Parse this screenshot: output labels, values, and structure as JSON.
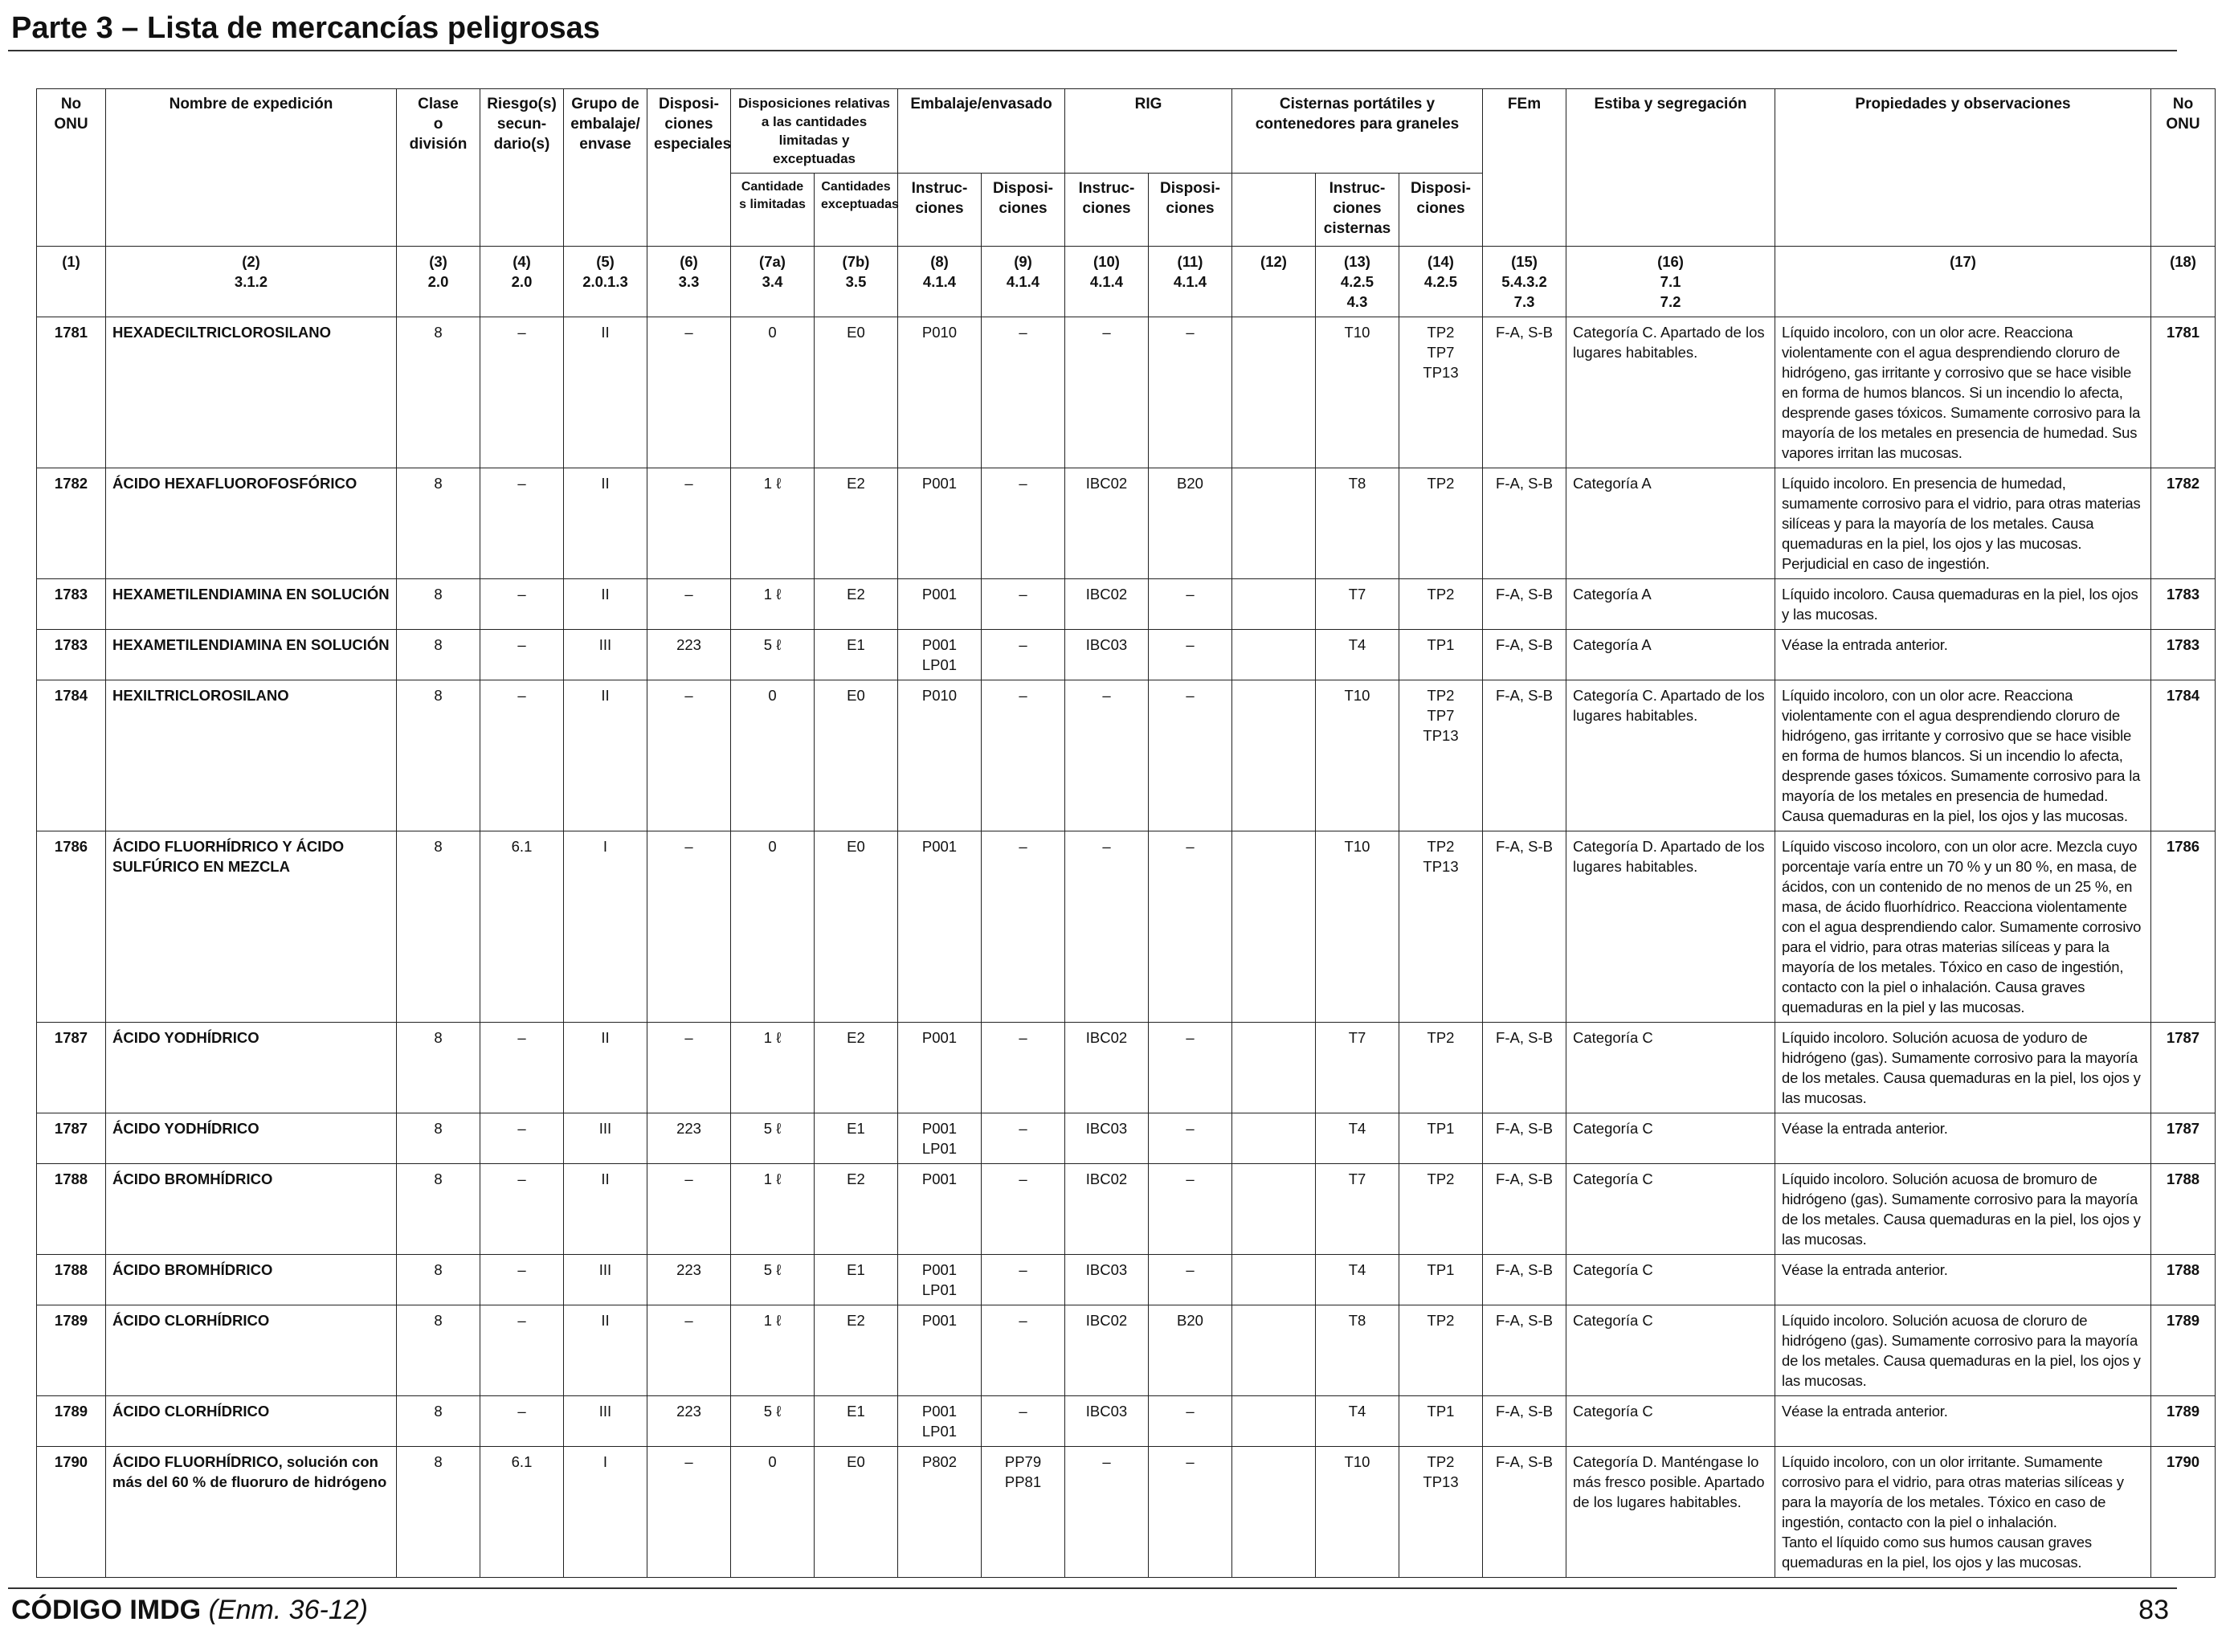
{
  "page": {
    "title": "Parte 3 – Lista de mercancías peligrosas",
    "footer_code": "CÓDIGO IMDG",
    "footer_amendment": "(Enm. 36-12)",
    "page_number": "83"
  },
  "table": {
    "headers": {
      "no_onu": "No\nONU",
      "nombre": "Nombre de expedición",
      "clase": "Clase\no\ndivisión",
      "riesgo": "Riesgo(s)\nsecun-\ndario(s)",
      "grupo": "Grupo de\nembalaje/\nenvase",
      "disposiciones": "Disposi-\nciones\nespeciales",
      "cantidades_group": "Disposiciones relativas\na las cantidades\nlimitadas y exceptuadas",
      "cantidad_limitada": "Cantidade\ns limitadas",
      "cantidad_exceptuada": "Cantidades\nexceptuadas",
      "embalaje_group": "Embalaje/envasado",
      "emb_instr": "Instruc-\nciones",
      "emb_disp": "Disposi-\nciones",
      "rig_group": "RIG",
      "rig_instr": "Instruc-\nciones",
      "rig_disp": "Disposi-\nciones",
      "cisternas_group": "Cisternas portátiles y\ncontenedores para graneles",
      "cist_instr": "Instruc-\nciones\ncisternas",
      "cist_disp": "Disposi-\nciones",
      "fem": "FEm",
      "estiba": "Estiba y segregación",
      "propiedades": "Propiedades y observaciones",
      "no_onu_right": "No\nONU"
    },
    "column_numbers": [
      "(1)",
      "(2)\n3.1.2",
      "(3)\n2.0",
      "(4)\n2.0",
      "(5)\n2.0.1.3",
      "(6)\n3.3",
      "(7a)\n3.4",
      "(7b)\n3.5",
      "(8)\n4.1.4",
      "(9)\n4.1.4",
      "(10)\n4.1.4",
      "(11)\n4.1.4",
      "(12)",
      "(13)\n4.2.5\n4.3",
      "(14)\n4.2.5",
      "(15)\n5.4.3.2\n7.3",
      "(16)\n7.1\n7.2",
      "(17)",
      "(18)"
    ],
    "rows": [
      {
        "c": [
          "1781",
          "HEXADECILTRICLOROSILANO",
          "8",
          "–",
          "II",
          "–",
          "0",
          "E0",
          "P010",
          "–",
          "–",
          "–",
          "",
          "T10",
          "TP2\nTP7\nTP13",
          "F-A, S-B",
          "Categoría C. Apartado de los lugares habitables.",
          "Líquido incoloro, con un olor acre. Reacciona violentamente con el agua desprendiendo cloruro de hidrógeno, gas irritante y corrosivo que se hace visible en forma de humos blancos. Si un incendio lo afecta, desprende gases tóxicos. Sumamente corrosivo para la mayoría de los metales en presencia de humedad. Sus vapores irritan las mucosas.",
          "1781"
        ]
      },
      {
        "c": [
          "1782",
          "ÁCIDO HEXAFLUOROFOSFÓRICO",
          "8",
          "–",
          "II",
          "–",
          "1 ℓ",
          "E2",
          "P001",
          "–",
          "IBC02",
          "B20",
          "",
          "T8",
          "TP2",
          "F-A, S-B",
          "Categoría A",
          "Líquido incoloro. En presencia de humedad, sumamente corrosivo para el vidrio, para otras materias silíceas y para la mayoría de los metales. Causa quemaduras en la piel, los ojos y las mucosas. Perjudicial en caso de ingestión.",
          "1782"
        ]
      },
      {
        "c": [
          "1783",
          "HEXAMETILENDIAMINA EN SOLUCIÓN",
          "8",
          "–",
          "II",
          "–",
          "1 ℓ",
          "E2",
          "P001",
          "–",
          "IBC02",
          "–",
          "",
          "T7",
          "TP2",
          "F-A, S-B",
          "Categoría A",
          "Líquido incoloro. Causa quemaduras en la piel, los ojos y las mucosas.",
          "1783"
        ]
      },
      {
        "c": [
          "1783",
          "HEXAMETILENDIAMINA EN SOLUCIÓN",
          "8",
          "–",
          "III",
          "223",
          "5 ℓ",
          "E1",
          "P001\nLP01",
          "–",
          "IBC03",
          "–",
          "",
          "T4",
          "TP1",
          "F-A, S-B",
          "Categoría A",
          "Véase la entrada anterior.",
          "1783"
        ]
      },
      {
        "c": [
          "1784",
          "HEXILTRICLOROSILANO",
          "8",
          "–",
          "II",
          "–",
          "0",
          "E0",
          "P010",
          "–",
          "–",
          "–",
          "",
          "T10",
          "TP2\nTP7\nTP13",
          "F-A, S-B",
          "Categoría C. Apartado de los lugares habitables.",
          "Líquido incoloro, con un olor acre. Reacciona violentamente con el agua desprendiendo cloruro de hidrógeno, gas irritante y corrosivo que se hace visible en forma de humos blancos. Si un incendio lo afecta, desprende gases tóxicos. Sumamente corrosivo para la mayoría de los metales en presencia de humedad. Causa quemaduras en la piel, los ojos y las mucosas.",
          "1784"
        ]
      },
      {
        "c": [
          "1786",
          "ÁCIDO FLUORHÍDRICO Y ÁCIDO SULFÚRICO EN MEZCLA",
          "8",
          "6.1",
          "I",
          "–",
          "0",
          "E0",
          "P001",
          "–",
          "–",
          "–",
          "",
          "T10",
          "TP2\nTP13",
          "F-A, S-B",
          "Categoría D. Apartado de los lugares habitables.",
          "Líquido viscoso incoloro, con un olor acre. Mezcla cuyo porcentaje varía entre un 70 % y un 80 %, en masa, de ácidos, con un contenido de no menos de un 25 %, en masa, de ácido fluorhídrico. Reacciona violentamente con el agua desprendiendo calor. Sumamente corrosivo para el vidrio, para otras materias silíceas y para la mayoría de los metales. Tóxico en caso de ingestión, contacto con la piel o inhalación. Causa graves quemaduras en la piel y las mucosas.",
          "1786"
        ]
      },
      {
        "c": [
          "1787",
          "ÁCIDO YODHÍDRICO",
          "8",
          "–",
          "II",
          "–",
          "1 ℓ",
          "E2",
          "P001",
          "–",
          "IBC02",
          "–",
          "",
          "T7",
          "TP2",
          "F-A, S-B",
          "Categoría C",
          "Líquido incoloro. Solución acuosa de yoduro de hidrógeno (gas). Sumamente corrosivo para la mayoría de los metales. Causa quemaduras en la piel, los ojos y las mucosas.",
          "1787"
        ]
      },
      {
        "c": [
          "1787",
          "ÁCIDO YODHÍDRICO",
          "8",
          "–",
          "III",
          "223",
          "5 ℓ",
          "E1",
          "P001\nLP01",
          "–",
          "IBC03",
          "–",
          "",
          "T4",
          "TP1",
          "F-A, S-B",
          "Categoría C",
          "Véase la entrada anterior.",
          "1787"
        ]
      },
      {
        "c": [
          "1788",
          "ÁCIDO BROMHÍDRICO",
          "8",
          "–",
          "II",
          "–",
          "1 ℓ",
          "E2",
          "P001",
          "–",
          "IBC02",
          "–",
          "",
          "T7",
          "TP2",
          "F-A, S-B",
          "Categoría C",
          "Líquido incoloro. Solución acuosa de bromuro de hidrógeno (gas). Sumamente corrosivo para la mayoría de los metales. Causa quemaduras en la piel, los ojos y las mucosas.",
          "1788"
        ]
      },
      {
        "c": [
          "1788",
          "ÁCIDO BROMHÍDRICO",
          "8",
          "–",
          "III",
          "223",
          "5 ℓ",
          "E1",
          "P001\nLP01",
          "–",
          "IBC03",
          "–",
          "",
          "T4",
          "TP1",
          "F-A, S-B",
          "Categoría C",
          "Véase la entrada anterior.",
          "1788"
        ]
      },
      {
        "c": [
          "1789",
          "ÁCIDO CLORHÍDRICO",
          "8",
          "–",
          "II",
          "–",
          "1 ℓ",
          "E2",
          "P001",
          "–",
          "IBC02",
          "B20",
          "",
          "T8",
          "TP2",
          "F-A, S-B",
          "Categoría C",
          "Líquido incoloro. Solución acuosa de cloruro de hidrógeno (gas). Sumamente corrosivo para la mayoría de los metales. Causa quemaduras en la piel, los ojos y las mucosas.",
          "1789"
        ]
      },
      {
        "c": [
          "1789",
          "ÁCIDO CLORHÍDRICO",
          "8",
          "–",
          "III",
          "223",
          "5 ℓ",
          "E1",
          "P001\nLP01",
          "–",
          "IBC03",
          "–",
          "",
          "T4",
          "TP1",
          "F-A, S-B",
          "Categoría C",
          "Véase la entrada anterior.",
          "1789"
        ]
      },
      {
        "c": [
          "1790",
          "ÁCIDO FLUORHÍDRICO, solución con más del 60 % de fluoruro de hidrógeno",
          "8",
          "6.1",
          "I",
          "–",
          "0",
          "E0",
          "P802",
          "PP79\nPP81",
          "–",
          "–",
          "",
          "T10",
          "TP2\nTP13",
          "F-A, S-B",
          "Categoría D. Manténgase lo más fresco posible. Apartado de los lugares habitables.",
          "Líquido incoloro, con un olor irritante. Sumamente corrosivo para el vidrio, para otras materias silíceas y para la mayoría de los metales. Tóxico en caso de ingestión, contacto con la piel o inhalación.\nTanto el líquido como sus humos causan graves quemaduras en la piel, los ojos y las mucosas.",
          "1790"
        ]
      }
    ]
  }
}
